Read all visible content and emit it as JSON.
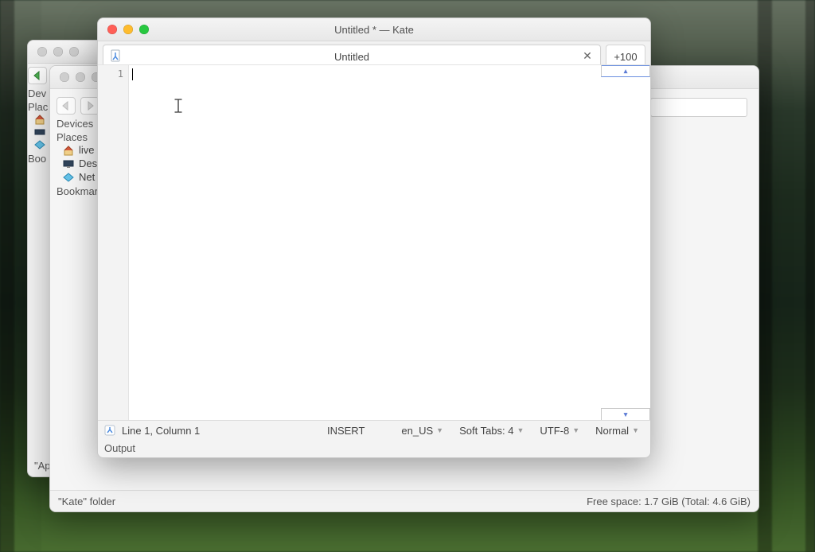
{
  "desktop": {},
  "fm_back": {
    "devices_label": "Dev",
    "places_label": "Plac",
    "bookmarks_label": "Boo"
  },
  "fm_mid": {
    "devices_label": "Devices",
    "places_label": "Places",
    "items": {
      "live": "live",
      "desktop": "Des",
      "network": "Net"
    },
    "bookmarks_label": "Bookmar",
    "status_left": "\"Kate\" folder",
    "status_right": "Free space: 1.7 GiB (Total: 4.6 GiB)"
  },
  "ap_window": {
    "footer": "\"Ap"
  },
  "kate": {
    "window_title": "Untitled * — Kate",
    "tab": {
      "title": "Untitled",
      "close_glyph": "✕"
    },
    "overflow_label": "+100",
    "gutter_first_line": "1",
    "minimap_up_glyph": "▴",
    "minimap_down_glyph": "▾",
    "status": {
      "position": "Line 1, Column 1",
      "insert_mode": "INSERT",
      "locale": "en_US",
      "indent": "Soft Tabs: 4",
      "encoding": "UTF-8",
      "mode": "Normal",
      "output_label": "Output"
    }
  }
}
